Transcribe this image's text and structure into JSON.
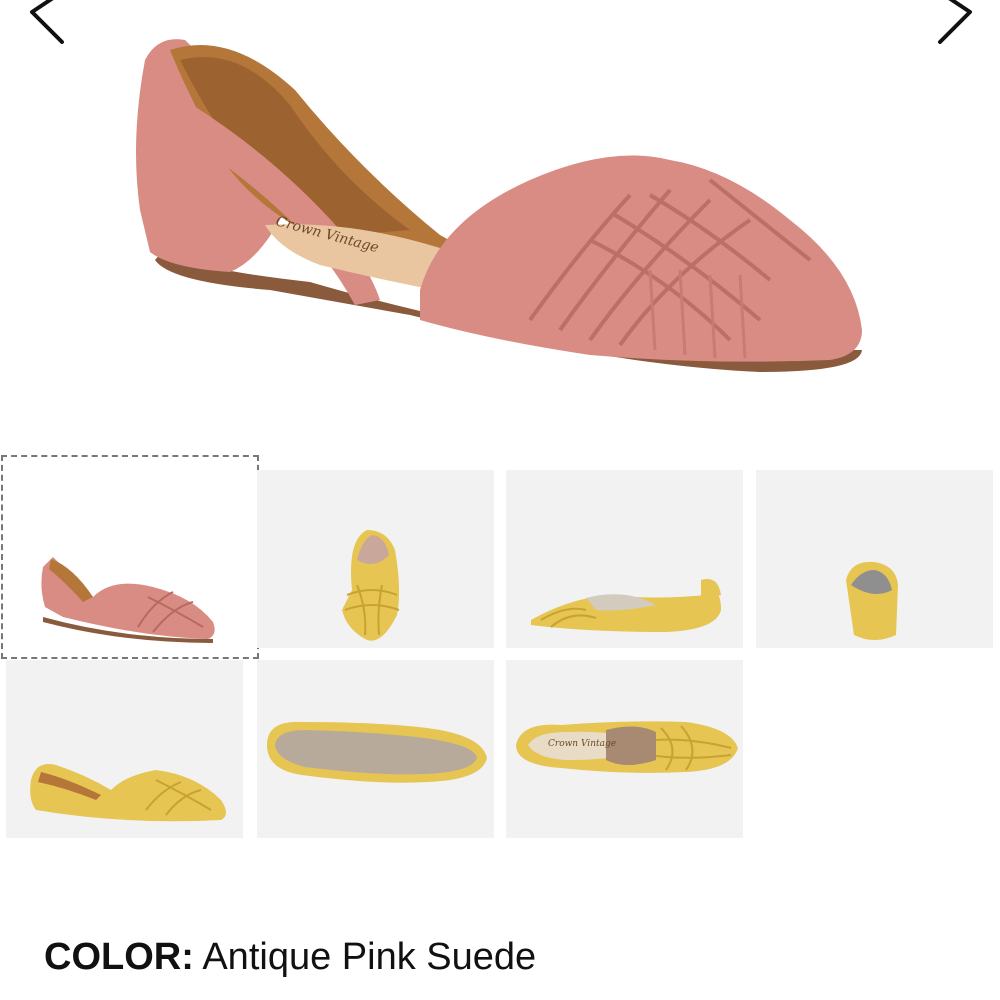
{
  "navigation": {
    "prev_icon": "chevron-left-icon",
    "next_icon": "chevron-right-icon"
  },
  "hero_image": {
    "subject": "shoe",
    "color": "#d98c84"
  },
  "thumbnails": [
    {
      "view": "side",
      "color": "#d98c84",
      "selected": true
    },
    {
      "view": "top",
      "color": "#e6c552",
      "selected": false
    },
    {
      "view": "inner-side",
      "color": "#e6c552",
      "selected": false
    },
    {
      "view": "back",
      "color": "#e6c552",
      "selected": false
    },
    {
      "view": "side",
      "color": "#e6c552",
      "selected": false
    },
    {
      "view": "sole",
      "color": "#e6c552",
      "selected": false
    },
    {
      "view": "top-angle",
      "color": "#e6c552",
      "selected": false
    }
  ],
  "product": {
    "color_label": "COLOR:",
    "color_value": " Antique Pink Suede"
  },
  "colors": {
    "pink_suede": "#d98c84",
    "mustard_suede": "#e6c552",
    "thumb_bg": "#f2f2f2",
    "text": "#111111"
  }
}
